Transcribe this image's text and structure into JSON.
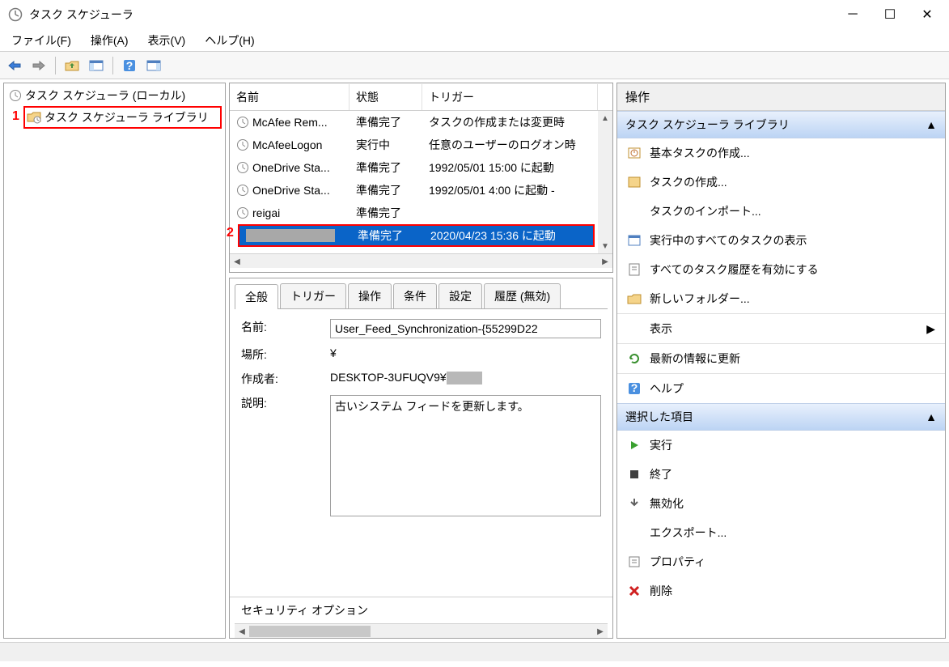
{
  "window": {
    "title": "タスク スケジューラ"
  },
  "menu": {
    "file": "ファイル(F)",
    "action": "操作(A)",
    "view": "表示(V)",
    "help": "ヘルプ(H)"
  },
  "tree": {
    "root": "タスク スケジューラ (ローカル)",
    "library": "タスク スケジューラ ライブラリ"
  },
  "annotations": {
    "one": "1",
    "two": "2"
  },
  "tasklist": {
    "headers": {
      "name": "名前",
      "status": "状態",
      "trigger": "トリガー"
    },
    "rows": [
      {
        "name": "McAfee Rem...",
        "status": "準備完了",
        "trigger": "タスクの作成または変更時"
      },
      {
        "name": "McAfeeLogon",
        "status": "実行中",
        "trigger": "任意のユーザーのログオン時"
      },
      {
        "name": "OneDrive Sta...",
        "status": "準備完了",
        "trigger": "1992/05/01 15:00 に起動"
      },
      {
        "name": "OneDrive Sta...",
        "status": "準備完了",
        "trigger": "1992/05/01 4:00 に起動 -"
      },
      {
        "name": "reigai",
        "status": "準備完了",
        "trigger": ""
      }
    ],
    "selected": {
      "name": "",
      "status": "準備完了",
      "trigger": "2020/04/23 15:36 に起動"
    }
  },
  "details": {
    "tabs": {
      "general": "全般",
      "triggers": "トリガー",
      "actions": "操作",
      "conditions": "条件",
      "settings": "設定",
      "history": "履歴 (無効)"
    },
    "labels": {
      "name": "名前:",
      "location": "場所:",
      "author": "作成者:",
      "description": "説明:"
    },
    "values": {
      "name": "User_Feed_Synchronization-{55299D22",
      "location": "¥",
      "author": "DESKTOP-3UFUQV9¥",
      "description": "古いシステム フィードを更新します。"
    },
    "security_options": "セキュリティ オプション"
  },
  "actions": {
    "header": "操作",
    "section1": {
      "title": "タスク スケジューラ ライブラリ"
    },
    "items1": [
      "基本タスクの作成...",
      "タスクの作成...",
      "タスクのインポート...",
      "実行中のすべてのタスクの表示",
      "すべてのタスク履歴を有効にする",
      "新しいフォルダー...",
      "表示",
      "最新の情報に更新",
      "ヘルプ"
    ],
    "section2": {
      "title": "選択した項目"
    },
    "items2": [
      "実行",
      "終了",
      "無効化",
      "エクスポート...",
      "プロパティ",
      "削除"
    ]
  }
}
